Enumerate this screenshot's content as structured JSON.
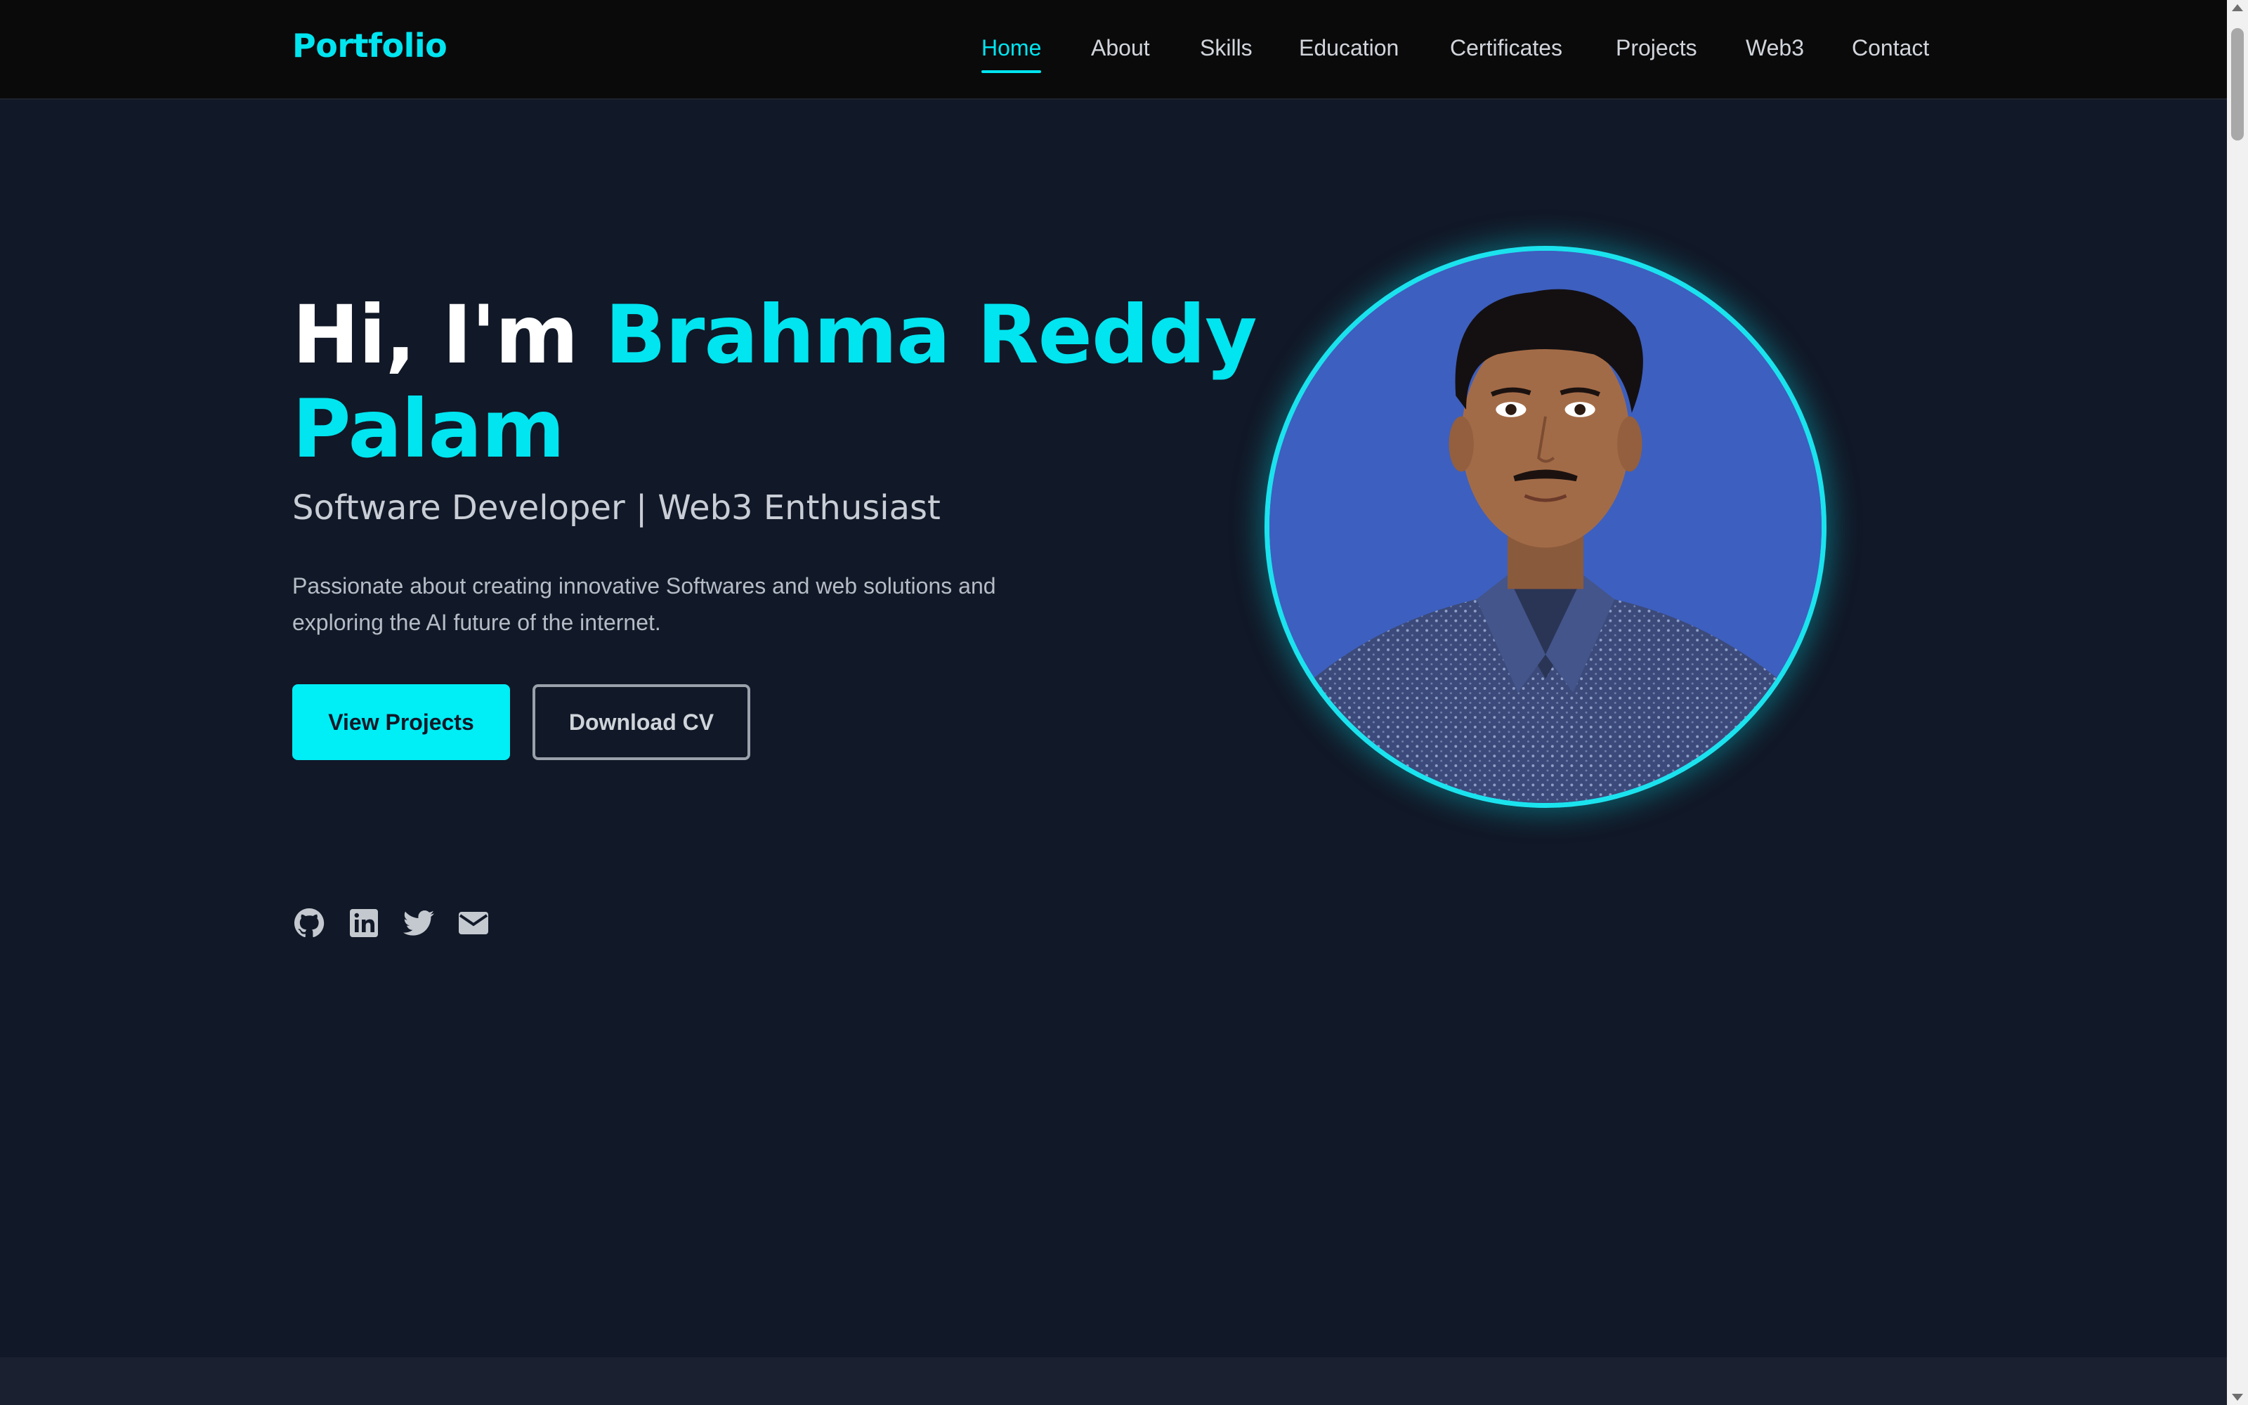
{
  "brand": {
    "logo": "Portfolio",
    "accent_color": "#00e5f0"
  },
  "nav": {
    "items": [
      {
        "label": "Home",
        "active": true
      },
      {
        "label": "About",
        "active": false
      },
      {
        "label": "Skills",
        "active": false
      },
      {
        "label": "Education",
        "active": false
      },
      {
        "label": "Certificates",
        "active": false
      },
      {
        "label": "Projects",
        "active": false
      },
      {
        "label": "Web3",
        "active": false
      },
      {
        "label": "Contact",
        "active": false
      }
    ]
  },
  "hero": {
    "greeting": "Hi, I'm ",
    "name": "Brahma Reddy Palam",
    "subtitle": "Software Developer | Web3 Enthusiast",
    "description": "Passionate about creating innovative Softwares and web solutions and exploring the AI future of the internet.",
    "primary_button": "View Projects",
    "secondary_button": "Download CV"
  },
  "socials": [
    {
      "icon": "github-icon"
    },
    {
      "icon": "linkedin-icon"
    },
    {
      "icon": "twitter-icon"
    },
    {
      "icon": "email-icon"
    }
  ],
  "profile": {
    "photo": "profile-photo"
  },
  "colors": {
    "background": "#111827",
    "navbar": "#0a0a0b",
    "accent": "#00e5f0"
  }
}
